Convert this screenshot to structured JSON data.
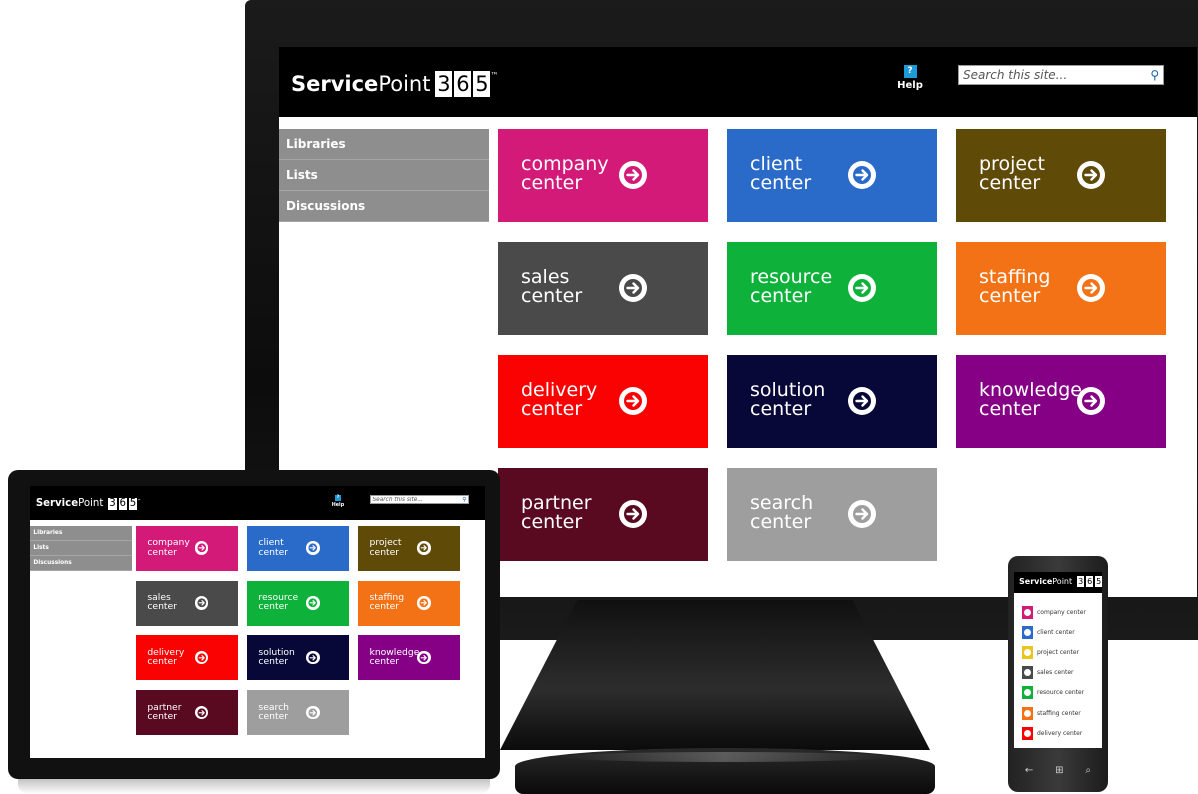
{
  "brand": {
    "name_bold": "Service",
    "name_regular": "Point",
    "digits": [
      "3",
      "6",
      "5"
    ],
    "trademark": "™"
  },
  "header": {
    "help_label": "Help",
    "help_icon": "?",
    "search_placeholder": "Search this site...",
    "search_icon": "magnifier-icon"
  },
  "nav": {
    "items": [
      "Libraries",
      "Lists",
      "Discussions"
    ]
  },
  "tiles": [
    {
      "line1": "company",
      "line2": "center",
      "color": "#d31a79"
    },
    {
      "line1": "client",
      "line2": "center",
      "color": "#2a6bc9"
    },
    {
      "line1": "project",
      "line2": "center",
      "color": "#604a08"
    },
    {
      "line1": "sales",
      "line2": "center",
      "color": "#4a4a4a"
    },
    {
      "line1": "resource",
      "line2": "center",
      "color": "#0eb23a"
    },
    {
      "line1": "staffing",
      "line2": "center",
      "color": "#f47216"
    },
    {
      "line1": "delivery",
      "line2": "center",
      "color": "#fb0202"
    },
    {
      "line1": "solution",
      "line2": "center",
      "color": "#080838"
    },
    {
      "line1": "knowledge",
      "line2": "center",
      "color": "#860086"
    },
    {
      "line1": "partner",
      "line2": "center",
      "color": "#5a0a20"
    },
    {
      "line1": "search",
      "line2": "center",
      "color": "#9e9e9e"
    }
  ],
  "phone": {
    "items": [
      {
        "label": "company center",
        "color": "#d31a79"
      },
      {
        "label": "client center",
        "color": "#2a6bc9"
      },
      {
        "label": "project center",
        "color": "#e9c51d"
      },
      {
        "label": "sales center",
        "color": "#4a4a4a"
      },
      {
        "label": "resource center",
        "color": "#0eb23a"
      },
      {
        "label": "staffing center",
        "color": "#f47216"
      },
      {
        "label": "delivery center",
        "color": "#fb0202"
      }
    ],
    "buttons": [
      "←",
      "⊞",
      "⌕"
    ]
  }
}
